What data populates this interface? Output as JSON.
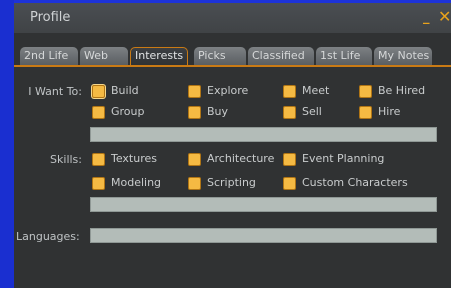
{
  "window": {
    "title": "Profile",
    "minimize_glyph": "_",
    "close_glyph": "✕"
  },
  "tabs": [
    {
      "label": "2nd Life",
      "active": false
    },
    {
      "label": "Web",
      "active": false
    },
    {
      "label": "Interests",
      "active": true
    },
    {
      "label": "Picks",
      "active": false
    },
    {
      "label": "Classified",
      "active": false
    },
    {
      "label": "1st Life",
      "active": false
    },
    {
      "label": "My Notes",
      "active": false
    }
  ],
  "want_to": {
    "label": "I Want To:",
    "options": [
      "Build",
      "Explore",
      "Meet",
      "Be Hired",
      "Group",
      "Buy",
      "Sell",
      "Hire"
    ],
    "other_value": ""
  },
  "skills": {
    "label": "Skills:",
    "options": [
      "Textures",
      "Architecture",
      "Event Planning",
      "Modeling",
      "Scripting",
      "Custom Characters"
    ],
    "other_value": ""
  },
  "languages": {
    "label": "Languages:",
    "value": ""
  },
  "colors": {
    "accent": "#c97a14",
    "checkbox": "#f5ba43",
    "field": "#b3bcb8",
    "border_blue": "#1a2fd0"
  }
}
